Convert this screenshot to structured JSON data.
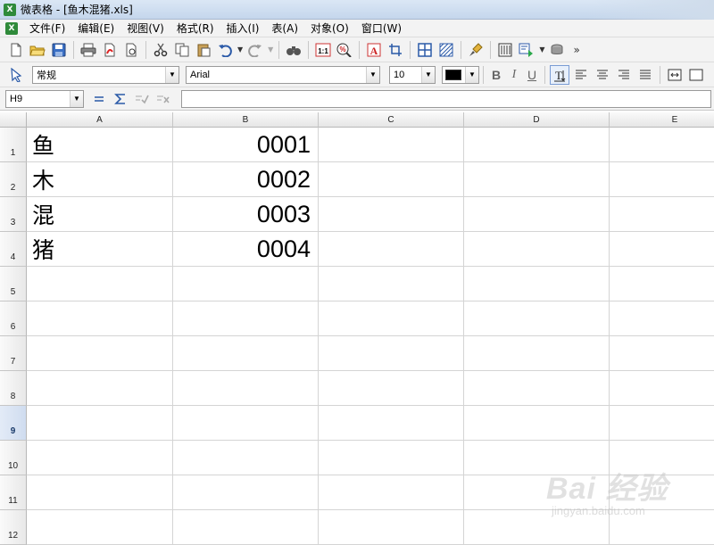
{
  "window": {
    "title": "微表格 - [鱼木混猪.xls]",
    "app_icon_letter": "X"
  },
  "menubar": {
    "items": [
      "文件(F)",
      "编辑(E)",
      "视图(V)",
      "格式(R)",
      "插入(I)",
      "表(A)",
      "对象(O)",
      "窗口(W)"
    ]
  },
  "toolbar_format": {
    "style_value": "常规",
    "font_value": "Arial",
    "size_value": "10",
    "font_color": "#000000",
    "bold_label": "B",
    "italic_label": "I",
    "underline_label": "U"
  },
  "formula_bar": {
    "cell_ref": "H9",
    "content": ""
  },
  "sheet": {
    "columns": [
      "A",
      "B",
      "C",
      "D",
      "E"
    ],
    "rows": [
      "1",
      "2",
      "3",
      "4",
      "5",
      "6",
      "7",
      "8",
      "9",
      "10",
      "11",
      "12"
    ],
    "selected_row": "9",
    "cells": {
      "A1": "鱼",
      "B1": "0001",
      "A2": "木",
      "B2": "0002",
      "A3": "混",
      "B3": "0003",
      "A4": "猪",
      "B4": "0004"
    }
  },
  "watermark": {
    "main": "Bai 经验",
    "sub": "jingyan.baidu.com"
  }
}
